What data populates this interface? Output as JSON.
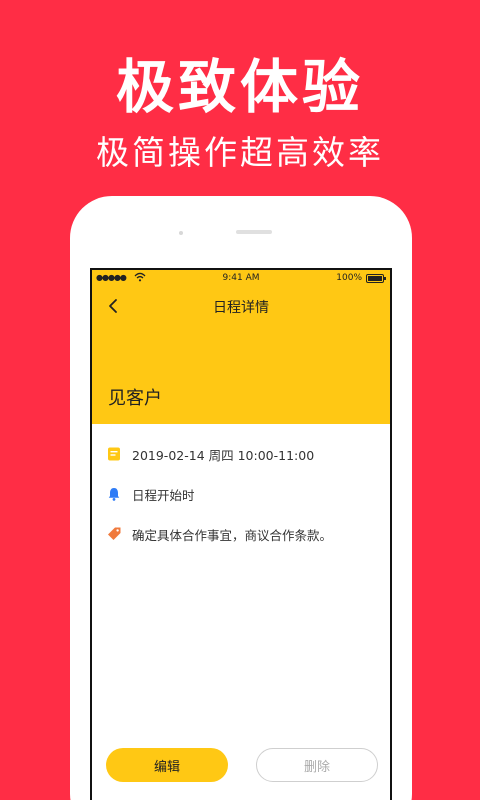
{
  "promo": {
    "title": "极致体验",
    "subtitle": "极简操作超高效率"
  },
  "statusbar": {
    "signal": "●●●●●",
    "time": "9:41 AM",
    "battery": "100%"
  },
  "nav": {
    "title": "日程详情"
  },
  "event": {
    "title": "见客户",
    "time": "2019-02-14 周四 10:00-11:00",
    "reminder": "日程开始时",
    "note": "确定具体合作事宜，商议合作条款。"
  },
  "actions": {
    "edit_label": "编辑",
    "delete_label": "删除"
  },
  "colors": {
    "background": "#ff2d45",
    "accent": "#ffc814",
    "reminder_icon": "#2f7cf6",
    "note_icon": "#f07a3c"
  },
  "icons": [
    "back-chevron-icon",
    "wifi-icon",
    "battery-icon",
    "calendar-note-icon",
    "bell-icon",
    "tag-icon"
  ]
}
